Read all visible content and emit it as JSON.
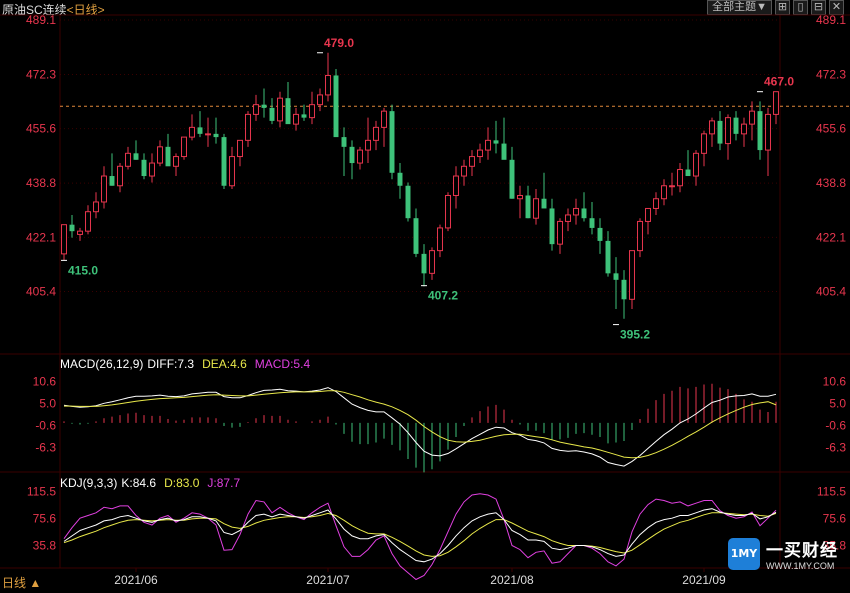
{
  "header": {
    "title": "原油SC连续",
    "period": "<日线>"
  },
  "toolbar": {
    "theme_label": "全部主题▼",
    "btn1": "⊞",
    "btn2": "▯",
    "btn3": "⊟",
    "btn4": "✕"
  },
  "bottom": {
    "period_label": "日线 ▲"
  },
  "logo": {
    "badge": "1MY",
    "name": "一买财经",
    "url": "WWW.1MY.COM"
  },
  "colors": {
    "up": "#e8364e",
    "down": "#3ec27a",
    "grid": "#3a0000",
    "axis": "#e8364e",
    "white": "#ffffff",
    "yellow": "#e8e84a",
    "magenta": "#e040e0"
  },
  "chart_data": [
    {
      "type": "candlestick",
      "name": "price",
      "yticks": [
        "489.1",
        "472.3",
        "455.6",
        "438.8",
        "422.1",
        "405.4"
      ],
      "ylim": [
        388.6,
        489.1
      ],
      "last_price_line": 462.5,
      "xticks": [
        {
          "label": "2021/06",
          "index": 9
        },
        {
          "label": "2021/07",
          "index": 33
        },
        {
          "label": "2021/08",
          "index": 56
        },
        {
          "label": "2021/09",
          "index": 80
        }
      ],
      "annotations": [
        {
          "label": "415.0",
          "index": 0,
          "value": 415.0,
          "kind": "low"
        },
        {
          "label": "479.0",
          "index": 32,
          "value": 479.0,
          "kind": "high"
        },
        {
          "label": "407.2",
          "index": 45,
          "value": 407.2,
          "kind": "low"
        },
        {
          "label": "395.2",
          "index": 69,
          "value": 395.2,
          "kind": "low"
        },
        {
          "label": "467.0",
          "index": 87,
          "value": 467.0,
          "kind": "high"
        }
      ],
      "candles": [
        [
          417,
          426,
          415,
          426
        ],
        [
          426,
          429,
          422,
          424
        ],
        [
          423,
          425,
          421,
          424
        ],
        [
          424,
          432,
          423,
          430
        ],
        [
          430,
          436,
          428,
          433
        ],
        [
          433,
          444,
          431,
          441
        ],
        [
          441,
          448,
          438,
          438
        ],
        [
          438,
          445,
          436,
          444
        ],
        [
          444,
          450,
          443,
          448
        ],
        [
          448,
          452,
          446,
          446
        ],
        [
          446,
          448,
          440,
          441
        ],
        [
          441,
          448,
          439,
          445
        ],
        [
          445,
          452,
          444,
          450
        ],
        [
          450,
          454,
          447,
          444
        ],
        [
          444,
          448,
          441,
          447
        ],
        [
          447,
          452,
          446,
          453
        ],
        [
          453,
          460,
          452,
          456
        ],
        [
          456,
          461,
          453,
          454
        ],
        [
          454,
          459,
          450,
          454
        ],
        [
          454,
          459,
          451,
          453
        ],
        [
          453,
          454,
          437,
          438
        ],
        [
          438,
          450,
          437,
          447
        ],
        [
          447,
          451,
          444,
          452
        ],
        [
          452,
          461,
          450,
          460
        ],
        [
          460,
          466,
          458,
          463
        ],
        [
          463,
          468,
          459,
          462
        ],
        [
          462,
          465,
          457,
          458
        ],
        [
          458,
          467,
          456,
          465
        ],
        [
          465,
          470,
          461,
          457
        ],
        [
          457,
          462,
          455,
          460
        ],
        [
          460,
          463,
          458,
          459
        ],
        [
          459,
          467,
          457,
          463
        ],
        [
          463,
          468,
          461,
          466
        ],
        [
          466,
          479,
          464,
          472
        ],
        [
          472,
          474,
          464,
          453
        ],
        [
          453,
          456,
          441,
          450
        ],
        [
          450,
          452,
          440,
          445
        ],
        [
          445,
          450,
          443,
          449
        ],
        [
          449,
          459,
          445,
          452
        ],
        [
          452,
          458,
          449,
          456
        ],
        [
          456,
          462,
          450,
          461
        ],
        [
          461,
          463,
          440,
          442
        ],
        [
          442,
          445,
          434,
          438
        ],
        [
          438,
          439,
          427,
          428
        ],
        [
          428,
          431,
          416,
          417
        ],
        [
          417,
          420,
          407,
          411
        ],
        [
          411,
          419,
          409,
          418
        ],
        [
          418,
          426,
          416,
          425
        ],
        [
          425,
          436,
          424,
          435
        ],
        [
          435,
          444,
          431,
          441
        ],
        [
          441,
          446,
          438,
          444
        ],
        [
          444,
          449,
          441,
          447
        ],
        [
          447,
          451,
          445,
          449
        ],
        [
          449,
          456,
          446,
          452
        ],
        [
          452,
          458,
          448,
          451
        ],
        [
          451,
          459,
          447,
          446
        ],
        [
          446,
          450,
          434,
          434
        ],
        [
          434,
          438,
          428,
          435
        ],
        [
          435,
          438,
          428,
          428
        ],
        [
          428,
          437,
          426,
          434
        ],
        [
          434,
          442,
          432,
          431
        ],
        [
          431,
          434,
          418,
          420
        ],
        [
          420,
          428,
          417,
          427
        ],
        [
          427,
          431,
          424,
          429
        ],
        [
          429,
          434,
          426,
          431
        ],
        [
          431,
          436,
          427,
          428
        ],
        [
          428,
          433,
          423,
          425
        ],
        [
          425,
          428,
          417,
          421
        ],
        [
          421,
          424,
          410,
          411
        ],
        [
          411,
          416,
          400,
          409
        ],
        [
          409,
          412,
          397,
          403
        ],
        [
          403,
          418,
          400,
          418
        ],
        [
          418,
          428,
          416,
          427
        ],
        [
          427,
          431,
          423,
          431
        ],
        [
          431,
          436,
          429,
          434
        ],
        [
          434,
          440,
          432,
          438
        ],
        [
          438,
          442,
          435,
          438
        ],
        [
          438,
          445,
          436,
          443
        ],
        [
          443,
          449,
          441,
          441
        ],
        [
          441,
          449,
          438,
          448
        ],
        [
          448,
          455,
          444,
          454
        ],
        [
          454,
          459,
          450,
          458
        ],
        [
          458,
          461,
          449,
          451
        ],
        [
          451,
          460,
          446,
          459
        ],
        [
          459,
          461,
          452,
          454
        ],
        [
          454,
          459,
          450,
          457
        ],
        [
          457,
          464,
          452,
          461
        ],
        [
          461,
          464,
          446,
          449
        ],
        [
          449,
          462,
          441,
          460
        ],
        [
          460,
          467,
          457,
          467
        ]
      ]
    },
    {
      "type": "line",
      "name": "MACD(26,12,9)",
      "header": [
        {
          "text": "MACD(26,12,9)",
          "color": "#ffffff"
        },
        {
          "text": "DIFF:7.3",
          "color": "#ffffff"
        },
        {
          "text": "DEA:4.6",
          "color": "#e8e84a"
        },
        {
          "text": "MACD:5.4",
          "color": "#e040e0"
        }
      ],
      "yticks": [
        "10.6",
        "5.0",
        "-0.6",
        "-6.3"
      ],
      "ylim": [
        -12.0,
        14.0
      ],
      "diff": [
        4.5,
        4.2,
        4.0,
        4.1,
        4.4,
        5.0,
        5.4,
        5.9,
        6.4,
        6.8,
        6.8,
        6.9,
        7.1,
        6.8,
        6.7,
        6.9,
        7.4,
        7.6,
        7.8,
        7.8,
        6.7,
        6.4,
        6.4,
        7.0,
        7.7,
        8.3,
        8.4,
        8.6,
        8.2,
        8.1,
        7.9,
        8.1,
        8.4,
        9.0,
        8.0,
        6.4,
        4.8,
        3.9,
        3.2,
        2.8,
        2.8,
        1.3,
        -0.3,
        -2.5,
        -5.0,
        -7.2,
        -8.2,
        -8.4,
        -7.8,
        -6.6,
        -5.3,
        -4.0,
        -2.9,
        -1.8,
        -1.1,
        -1.3,
        -2.5,
        -3.1,
        -4.2,
        -4.5,
        -5.1,
        -6.5,
        -7.0,
        -7.2,
        -7.1,
        -7.4,
        -7.9,
        -8.7,
        -10.1,
        -10.6,
        -11.0,
        -9.8,
        -8.3,
        -6.5,
        -4.7,
        -3.0,
        -1.6,
        0.0,
        1.0,
        2.3,
        3.8,
        5.2,
        5.8,
        6.6,
        6.9,
        7.0,
        7.4,
        6.8,
        6.8,
        7.3
      ],
      "dea": [
        4.3,
        4.3,
        4.2,
        4.2,
        4.2,
        4.4,
        4.6,
        4.9,
        5.2,
        5.5,
        5.8,
        6.0,
        6.2,
        6.3,
        6.4,
        6.5,
        6.7,
        6.9,
        7.1,
        7.2,
        7.1,
        7.0,
        6.9,
        6.9,
        7.1,
        7.3,
        7.5,
        7.7,
        7.8,
        7.9,
        7.9,
        7.9,
        8.0,
        8.2,
        8.2,
        7.8,
        7.2,
        6.6,
        5.9,
        5.3,
        4.8,
        4.1,
        3.2,
        2.1,
        0.7,
        -0.9,
        -2.3,
        -3.5,
        -4.4,
        -4.8,
        -4.9,
        -4.7,
        -4.4,
        -3.9,
        -3.4,
        -3.0,
        -2.9,
        -2.9,
        -3.2,
        -3.5,
        -3.8,
        -4.3,
        -4.9,
        -5.3,
        -5.7,
        -6.1,
        -6.4,
        -6.9,
        -7.5,
        -8.1,
        -8.7,
        -8.9,
        -8.8,
        -8.3,
        -7.6,
        -6.7,
        -5.7,
        -4.6,
        -3.4,
        -2.3,
        -1.1,
        0.2,
        1.3,
        2.3,
        3.2,
        4.0,
        4.7,
        5.1,
        5.4,
        4.6
      ],
      "macd": [
        0.4,
        -0.2,
        -0.4,
        -0.2,
        0.4,
        1.2,
        1.6,
        2.0,
        2.4,
        2.6,
        2.0,
        1.8,
        1.8,
        1.0,
        0.6,
        0.8,
        1.4,
        1.4,
        1.4,
        1.2,
        -0.8,
        -1.2,
        -1.0,
        0.2,
        1.2,
        2.0,
        1.8,
        1.8,
        0.8,
        0.4,
        0.0,
        0.4,
        0.8,
        1.6,
        -0.4,
        -2.8,
        -4.8,
        -5.4,
        -5.4,
        -5.0,
        -4.0,
        -5.6,
        -7.0,
        -9.2,
        -11.4,
        -12.6,
        -11.8,
        -9.8,
        -6.8,
        -3.6,
        -0.8,
        1.4,
        3.0,
        4.2,
        4.6,
        3.4,
        0.8,
        -0.4,
        -2.0,
        -2.0,
        -2.6,
        -4.4,
        -4.2,
        -3.8,
        -2.8,
        -2.6,
        -3.0,
        -3.6,
        -5.2,
        -5.0,
        -4.6,
        -1.8,
        1.0,
        3.6,
        5.8,
        7.4,
        8.2,
        9.2,
        8.8,
        9.2,
        9.8,
        10.0,
        9.0,
        8.6,
        7.4,
        6.0,
        5.4,
        3.4,
        2.8,
        5.4
      ]
    },
    {
      "type": "line",
      "name": "KDJ(9,3,3)",
      "header": [
        {
          "text": "KDJ(9,3,3)",
          "color": "#ffffff"
        },
        {
          "text": "K:84.6",
          "color": "#ffffff"
        },
        {
          "text": "D:83.0",
          "color": "#e8e84a"
        },
        {
          "text": "J:87.7",
          "color": "#e040e0"
        }
      ],
      "yticks": [
        "115.5",
        "75.6",
        "35.8"
      ],
      "ylim": [
        0,
        135
      ],
      "k": [
        42,
        50,
        58,
        62,
        66,
        72,
        74,
        78,
        80,
        76,
        72,
        70,
        74,
        76,
        72,
        74,
        78,
        78,
        76,
        72,
        55,
        52,
        58,
        70,
        80,
        82,
        78,
        82,
        80,
        78,
        76,
        80,
        84,
        88,
        75,
        60,
        50,
        46,
        46,
        50,
        52,
        40,
        30,
        22,
        14,
        12,
        16,
        24,
        36,
        50,
        62,
        72,
        78,
        82,
        84,
        74,
        58,
        52,
        44,
        44,
        42,
        32,
        30,
        32,
        36,
        36,
        34,
        30,
        24,
        20,
        22,
        38,
        52,
        62,
        70,
        74,
        76,
        80,
        80,
        84,
        88,
        90,
        85,
        82,
        80,
        80,
        83,
        75,
        78,
        84.6
      ],
      "d": [
        40,
        44,
        49,
        53,
        57,
        62,
        66,
        70,
        73,
        74,
        73,
        72,
        73,
        74,
        73,
        73,
        75,
        76,
        76,
        75,
        68,
        63,
        61,
        64,
        69,
        73,
        75,
        77,
        78,
        78,
        77,
        78,
        80,
        83,
        80,
        73,
        65,
        59,
        54,
        53,
        53,
        48,
        42,
        35,
        28,
        22,
        20,
        21,
        26,
        34,
        43,
        53,
        61,
        68,
        74,
        74,
        69,
        63,
        57,
        53,
        49,
        43,
        39,
        36,
        36,
        36,
        35,
        33,
        30,
        27,
        25,
        29,
        37,
        45,
        53,
        60,
        65,
        70,
        73,
        77,
        81,
        84,
        84,
        83,
        82,
        81,
        82,
        80,
        79,
        83.0
      ],
      "j": [
        46,
        62,
        76,
        80,
        84,
        92,
        90,
        94,
        94,
        80,
        70,
        66,
        76,
        80,
        70,
        76,
        84,
        82,
        76,
        66,
        29,
        30,
        52,
        82,
        102,
        100,
        84,
        92,
        84,
        78,
        74,
        84,
        92,
        98,
        65,
        34,
        20,
        20,
        30,
        44,
        50,
        24,
        6,
        -4,
        -14,
        -8,
        8,
        30,
        56,
        82,
        100,
        110,
        112,
        110,
        104,
        74,
        36,
        30,
        18,
        26,
        28,
        10,
        12,
        24,
        36,
        36,
        32,
        24,
        12,
        6,
        16,
        56,
        82,
        96,
        104,
        102,
        98,
        100,
        94,
        98,
        102,
        102,
        87,
        80,
        76,
        78,
        85,
        65,
        76,
        87.7
      ]
    }
  ]
}
